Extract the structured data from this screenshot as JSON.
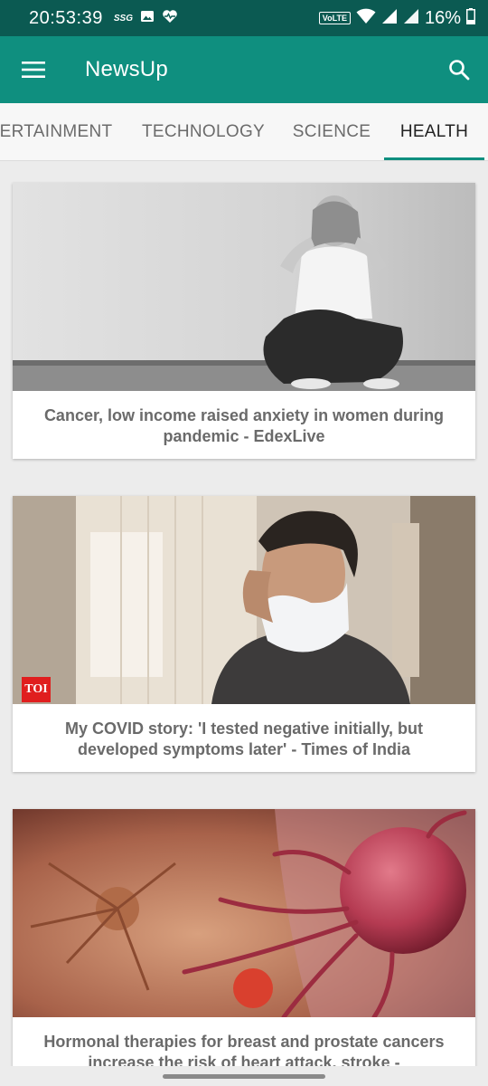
{
  "status_bar": {
    "time": "20:53:39",
    "ssg": "SSG",
    "volte": "VoLTE",
    "battery": "16%"
  },
  "app_bar": {
    "title": "NewsUp",
    "menu_icon": "hamburger-menu-icon",
    "search_icon": "search-icon"
  },
  "tabs": [
    {
      "label": "ERTAINMENT"
    },
    {
      "label": "TECHNOLOGY"
    },
    {
      "label": "SCIENCE"
    },
    {
      "label": "HEALTH",
      "active": true
    }
  ],
  "articles": [
    {
      "title": "Cancer, low income raised anxiety in women during pandemic - EdexLive"
    },
    {
      "title": "My COVID story: 'I tested negative initially, but developed symptoms later' - Times of India",
      "badge": "TOI"
    },
    {
      "title": "Hormonal therapies for breast and prostate cancers increase the risk of heart attack, stroke -"
    }
  ],
  "colors": {
    "status_bar": "#0b5a52",
    "primary": "#0f8f7f",
    "tab_indicator": "#0f8f7f"
  }
}
